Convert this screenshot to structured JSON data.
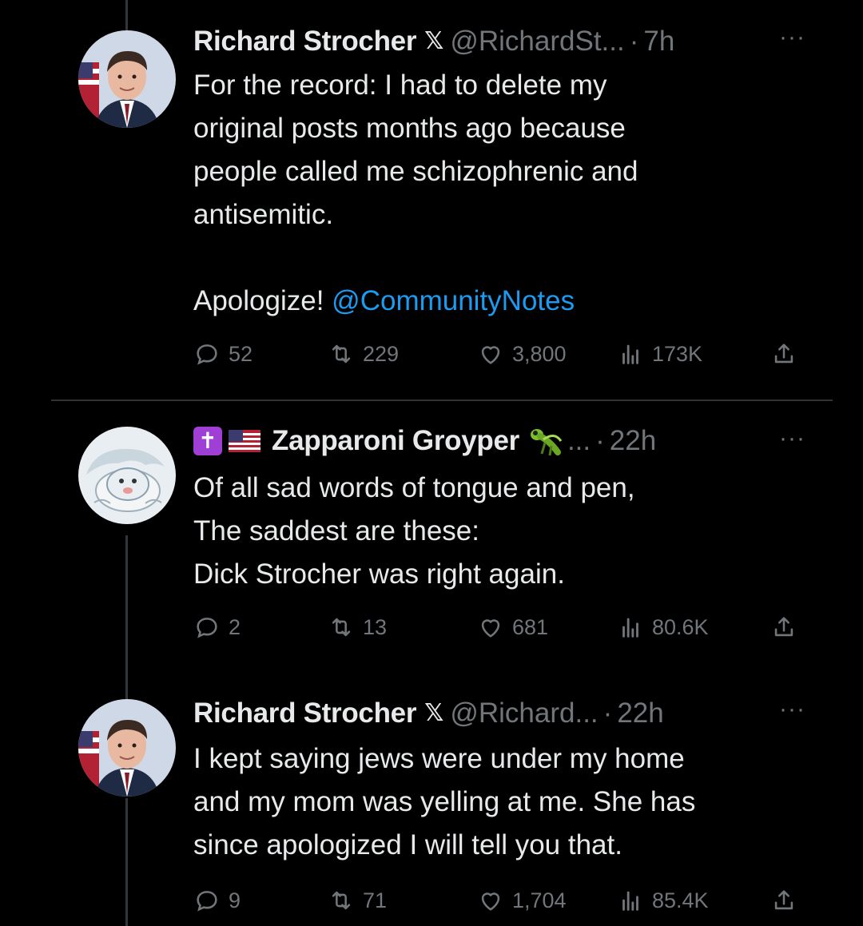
{
  "posts": [
    {
      "name": "Richard Strocher",
      "handle": "@RichardSt...",
      "separator": "·",
      "time": "7h",
      "more": "···",
      "body_before_mention": "For the record: I had to delete my\noriginal posts months ago because\npeople called me schizophrenic and\nantisemitic.\n\nApologize! ",
      "mention": "@CommunityNotes",
      "replies": "52",
      "reposts": "229",
      "likes": "3,800",
      "views": "173K"
    },
    {
      "name": "Zapparoni Groyper",
      "handle": "...",
      "separator": "·",
      "time": "22h",
      "more": "···",
      "body": "Of all sad words of tongue and pen,\nThe saddest are these:\nDick Strocher was right again.",
      "replies": "2",
      "reposts": "13",
      "likes": "681",
      "views": "80.6K"
    },
    {
      "name": "Richard Strocher",
      "handle": "@Richard...",
      "separator": "·",
      "time": "22h",
      "more": "···",
      "body": "I kept saying jews were under my home\nand my mom was yelling at me. She has\nsince apologized I will tell you that.",
      "replies": "9",
      "reposts": "71",
      "likes": "1,704",
      "views": "85.4K"
    }
  ],
  "icons": {
    "x_logo": "𝕏",
    "cross": "✝",
    "reply": "reply-icon",
    "repost": "repost-icon",
    "like": "like-icon",
    "views": "views-icon",
    "share": "share-icon"
  },
  "colors": {
    "background": "#000000",
    "text": "#e7e9ea",
    "muted": "#71767b",
    "link": "#1d9bf0",
    "divider": "#2f3336"
  }
}
